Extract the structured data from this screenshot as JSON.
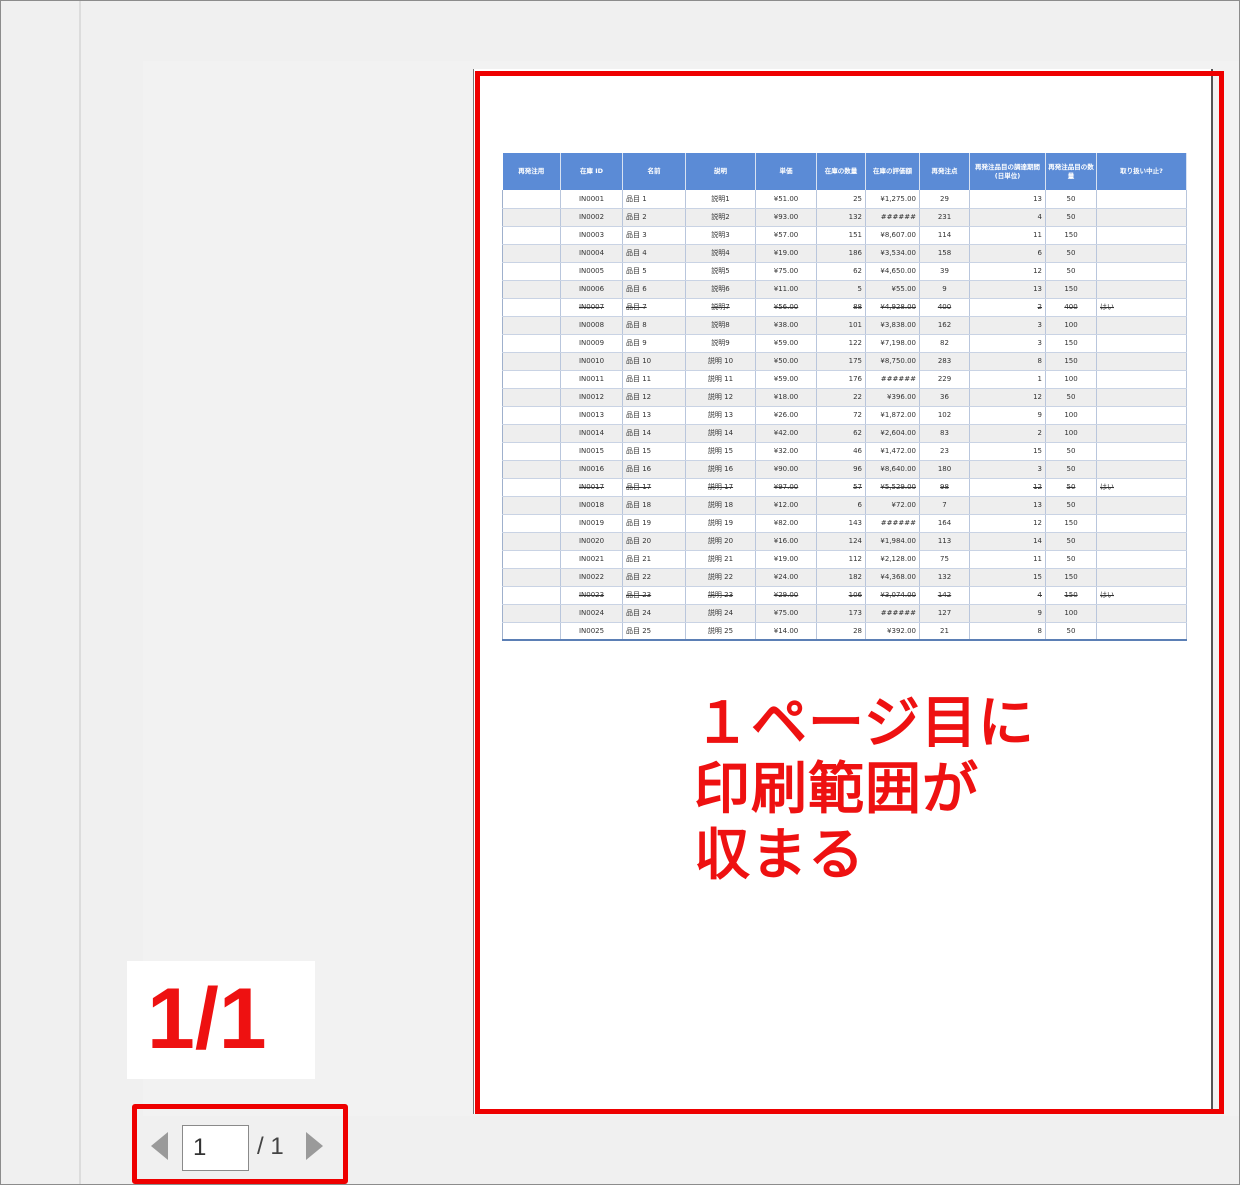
{
  "table": {
    "headers": [
      "再発注用",
      "在庫 ID",
      "名前",
      "説明",
      "単価",
      "在庫の数量",
      "在庫の評価額",
      "再発注点",
      "再発注品目の調達期間 (日単位)",
      "再発注品目の数量",
      "取り扱い中止?"
    ],
    "rows": [
      [
        "",
        "IN0001",
        "品目 1",
        "説明1",
        "¥51.00",
        "25",
        "¥1,275.00",
        "29",
        "13",
        "50",
        ""
      ],
      [
        "",
        "IN0002",
        "品目 2",
        "説明2",
        "¥93.00",
        "132",
        "######",
        "231",
        "4",
        "50",
        ""
      ],
      [
        "",
        "IN0003",
        "品目 3",
        "説明3",
        "¥57.00",
        "151",
        "¥8,607.00",
        "114",
        "11",
        "150",
        ""
      ],
      [
        "",
        "IN0004",
        "品目 4",
        "説明4",
        "¥19.00",
        "186",
        "¥3,534.00",
        "158",
        "6",
        "50",
        ""
      ],
      [
        "",
        "IN0005",
        "品目 5",
        "説明5",
        "¥75.00",
        "62",
        "¥4,650.00",
        "39",
        "12",
        "50",
        ""
      ],
      [
        "",
        "IN0006",
        "品目 6",
        "説明6",
        "¥11.00",
        "5",
        "¥55.00",
        "9",
        "13",
        "150",
        ""
      ],
      [
        "",
        "IN0007",
        "品目 7",
        "説明7",
        "¥56.00",
        "88",
        "¥4,928.00",
        "400",
        "2",
        "400",
        "はい"
      ],
      [
        "",
        "IN0008",
        "品目 8",
        "説明8",
        "¥38.00",
        "101",
        "¥3,838.00",
        "162",
        "3",
        "100",
        ""
      ],
      [
        "",
        "IN0009",
        "品目 9",
        "説明9",
        "¥59.00",
        "122",
        "¥7,198.00",
        "82",
        "3",
        "150",
        ""
      ],
      [
        "",
        "IN0010",
        "品目 10",
        "説明 10",
        "¥50.00",
        "175",
        "¥8,750.00",
        "283",
        "8",
        "150",
        ""
      ],
      [
        "",
        "IN0011",
        "品目 11",
        "説明 11",
        "¥59.00",
        "176",
        "######",
        "229",
        "1",
        "100",
        ""
      ],
      [
        "",
        "IN0012",
        "品目 12",
        "説明 12",
        "¥18.00",
        "22",
        "¥396.00",
        "36",
        "12",
        "50",
        ""
      ],
      [
        "",
        "IN0013",
        "品目 13",
        "説明 13",
        "¥26.00",
        "72",
        "¥1,872.00",
        "102",
        "9",
        "100",
        ""
      ],
      [
        "",
        "IN0014",
        "品目 14",
        "説明 14",
        "¥42.00",
        "62",
        "¥2,604.00",
        "83",
        "2",
        "100",
        ""
      ],
      [
        "",
        "IN0015",
        "品目 15",
        "説明 15",
        "¥32.00",
        "46",
        "¥1,472.00",
        "23",
        "15",
        "50",
        ""
      ],
      [
        "",
        "IN0016",
        "品目 16",
        "説明 16",
        "¥90.00",
        "96",
        "¥8,640.00",
        "180",
        "3",
        "50",
        ""
      ],
      [
        "",
        "IN0017",
        "品目 17",
        "説明 17",
        "¥97.00",
        "57",
        "¥5,529.00",
        "98",
        "12",
        "50",
        "はい"
      ],
      [
        "",
        "IN0018",
        "品目 18",
        "説明 18",
        "¥12.00",
        "6",
        "¥72.00",
        "7",
        "13",
        "50",
        ""
      ],
      [
        "",
        "IN0019",
        "品目 19",
        "説明 19",
        "¥82.00",
        "143",
        "######",
        "164",
        "12",
        "150",
        ""
      ],
      [
        "",
        "IN0020",
        "品目 20",
        "説明 20",
        "¥16.00",
        "124",
        "¥1,984.00",
        "113",
        "14",
        "50",
        ""
      ],
      [
        "",
        "IN0021",
        "品目 21",
        "説明 21",
        "¥19.00",
        "112",
        "¥2,128.00",
        "75",
        "11",
        "50",
        ""
      ],
      [
        "",
        "IN0022",
        "品目 22",
        "説明 22",
        "¥24.00",
        "182",
        "¥4,368.00",
        "132",
        "15",
        "150",
        ""
      ],
      [
        "",
        "IN0023",
        "品目 23",
        "説明 23",
        "¥29.00",
        "106",
        "¥3,074.00",
        "142",
        "4",
        "150",
        "はい"
      ],
      [
        "",
        "IN0024",
        "品目 24",
        "説明 24",
        "¥75.00",
        "173",
        "######",
        "127",
        "9",
        "100",
        ""
      ],
      [
        "",
        "IN0025",
        "品目 25",
        "説明 25",
        "¥14.00",
        "28",
        "¥392.00",
        "21",
        "8",
        "50",
        ""
      ]
    ],
    "discontinued_rows": [
      6,
      16,
      22
    ]
  },
  "annotation": {
    "lines": [
      "１ページ目に",
      "印刷範囲が",
      "収まる"
    ]
  },
  "page_count_label": "1/1",
  "navigation": {
    "current_page": "1",
    "total_label": "/ 1",
    "prev_icon": "triangle-left-icon",
    "next_icon": "triangle-right-icon"
  },
  "colors": {
    "highlight": "#ee0000",
    "header_bg": "#5b8bd6",
    "alt_row": "#eeeeee"
  }
}
